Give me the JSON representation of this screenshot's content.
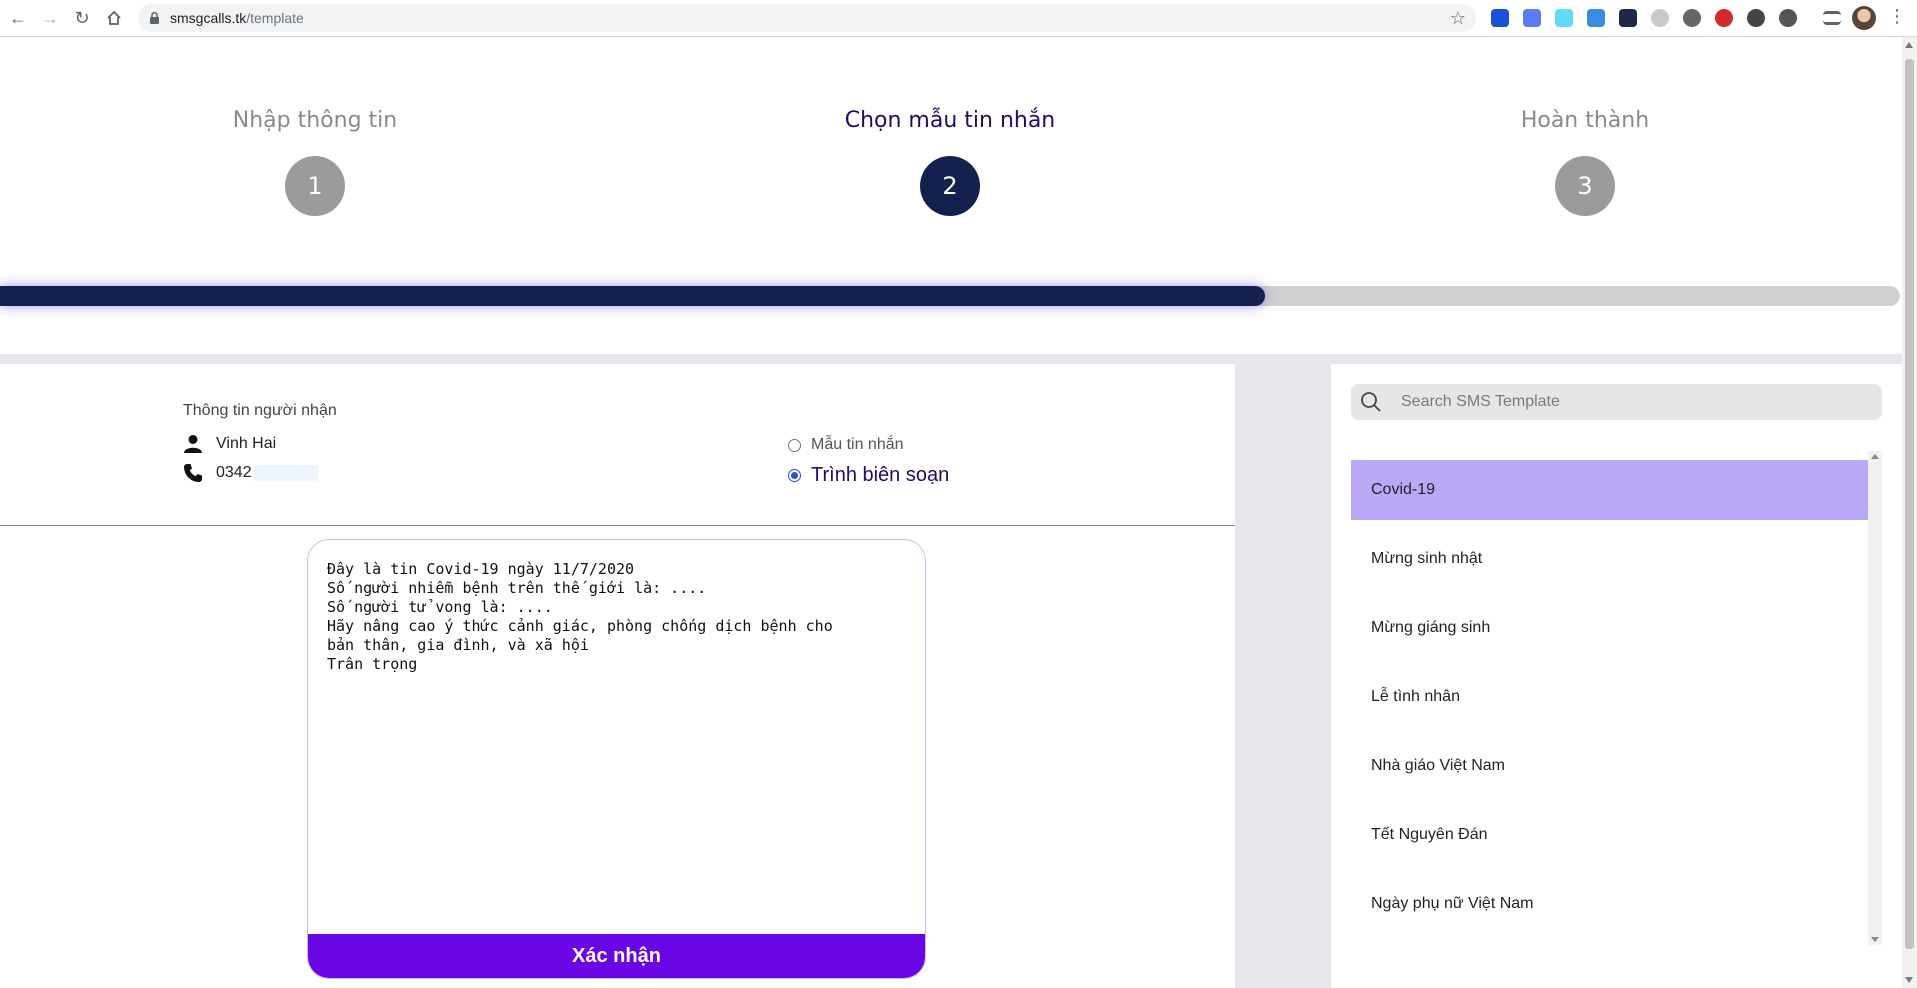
{
  "browser": {
    "url_host": "smsgcalls.tk",
    "url_path": "/template",
    "extension_colors": [
      "#1a4fd6",
      "#5b7cf0",
      "#61dafb",
      "#3a8de0",
      "#1c2a4a",
      "#c9c9c9",
      "#666666",
      "#d22b2b",
      "#444444",
      "#555555"
    ]
  },
  "stepper": {
    "steps": [
      {
        "label": "Nhập thông tin",
        "number": "1",
        "state": "done"
      },
      {
        "label": "Chọn mẫu tin nhắn",
        "number": "2",
        "state": "active"
      },
      {
        "label": "Hoàn thành",
        "number": "3",
        "state": "pending"
      }
    ],
    "progress_percent": 66.6,
    "accent_color": "#13214f",
    "inactive_color": "#9b9b9b"
  },
  "recipient": {
    "title": "Thông tin người nhận",
    "name": "Vinh Hai",
    "phone_visible": "0342"
  },
  "mode": {
    "options": [
      {
        "label": "Mẫu tin nhắn",
        "checked": false
      },
      {
        "label": "Trình biên soạn",
        "checked": true
      }
    ]
  },
  "editor": {
    "content": "Đây là tin Covid-19 ngày 11/7/2020\nSố người nhiễm bệnh trên thế giới là: ....\nSố người tử vong là: ....\nHãy nâng cao ý thức cảnh giác, phòng chống dịch bệnh cho\nbản thân, gia đình, và xã hội\nTrân trọng",
    "submit_label": "Xác nhận",
    "submit_color": "#6a06e6"
  },
  "templates": {
    "search_placeholder": "Search SMS Template",
    "items": [
      {
        "label": "Covid-19",
        "selected": true
      },
      {
        "label": "Mừng sinh nhật",
        "selected": false
      },
      {
        "label": "Mừng giáng sinh",
        "selected": false
      },
      {
        "label": "Lễ tình nhân",
        "selected": false
      },
      {
        "label": "Nhà giáo Việt Nam",
        "selected": false
      },
      {
        "label": "Tết Nguyên Đán",
        "selected": false
      },
      {
        "label": "Ngày phụ nữ Việt Nam",
        "selected": false
      }
    ],
    "selected_color": "#bba8f7"
  }
}
